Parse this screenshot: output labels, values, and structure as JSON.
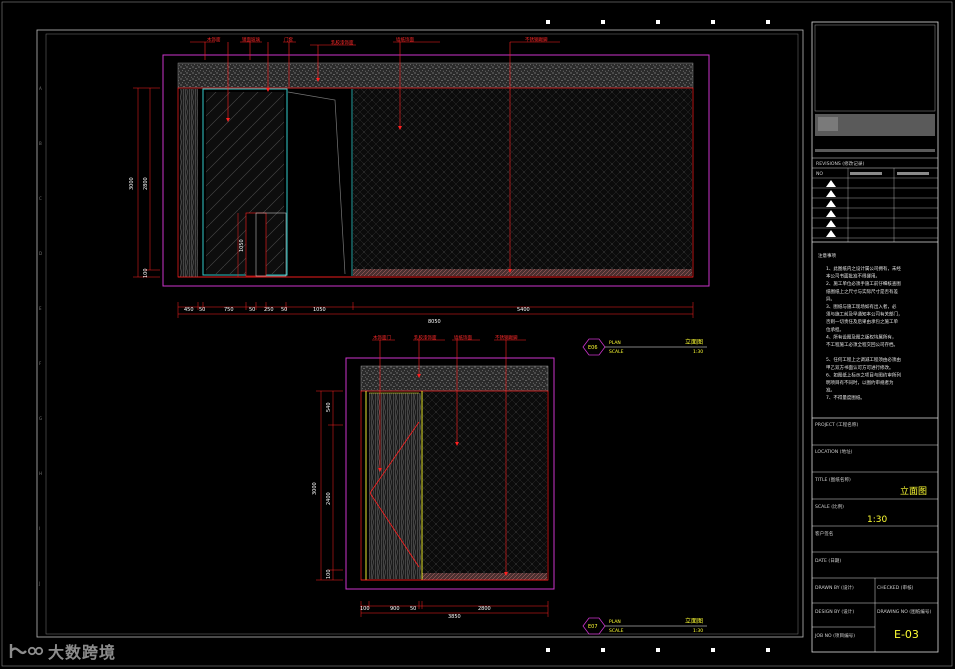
{
  "drawing": {
    "elevation_top": {
      "callouts": [
        "木饰面",
        "镜面玻璃",
        "门套",
        "乳胶漆饰面",
        "墙纸饰面",
        "不锈钢踢脚"
      ],
      "height_dims": [
        "3000",
        "2800",
        "100"
      ],
      "door_dim": "1050",
      "width_dims": [
        "450",
        "50",
        "750",
        "50",
        "250",
        "50",
        "1050",
        "5400"
      ],
      "total_width": "8050",
      "marker": {
        "code": "E06",
        "plan": "PLAN",
        "scale_word": "SCALE",
        "title": "立面图",
        "scale": "1:30"
      }
    },
    "elevation_bottom": {
      "callouts": [
        "木饰面门",
        "乳胶漆饰面",
        "墙纸饰面",
        "不锈钢踢脚"
      ],
      "height_dims": [
        "3000",
        "540",
        "2400",
        "100"
      ],
      "width_dims": [
        "100",
        "900",
        "50",
        "2800"
      ],
      "total_width": "3850",
      "marker": {
        "code": "E07",
        "plan": "PLAN",
        "scale_word": "SCALE",
        "title": "立面图",
        "scale": "1:30"
      }
    }
  },
  "title_block": {
    "revisions_header": "REVISIONS (修改记录)",
    "rev_col_no": "NO",
    "rev_col_date": "DATE",
    "notes_title": "注意事项",
    "notes": [
      "1、此图纸内之设计属公司拥有，未经",
      "本公司书面批准不得挪用。",
      "2、施工单位必须手施工前仔细核查图",
      "纸图纸上之尺寸与实际尺寸是否有差",
      "异。",
      "3、图纸与施工现场如有出入者，必",
      "须与施工前及早通知本公司有关部门，",
      "否则一切责任及后果由承包之施工单",
      "位承担。",
      "4、所有设图及图之版权均属所有，",
      "不工程施工必须全程交回公司存档。",
      "",
      "5、任何工程上之调减工程须由必须由",
      "甲乙双方书面认可方可进行修改。",
      "6、如图纸上标示之项目与图约审所列",
      "明项目有不同时，以图约审规者为",
      "准。",
      "7、不得量度图纸。"
    ],
    "project_label": "PROJECT (工程名称)",
    "location_label": "LOCATION (地址)",
    "title_label": "TITLE (图纸名称)",
    "title_value": "立面图",
    "scale_label": "SCALE (比例)",
    "scale_value": "1:30",
    "client_label": "客户签名",
    "date_label": "DATE (日期)",
    "drawn_label": "DRAWN BY (设计)",
    "checked_label": "CHECKED (审核)",
    "design_label": "DESIGN BY (设计)",
    "drawing_no_label": "DRAWING NO (图纸编号)",
    "job_label": "JOB NO (项目编号)",
    "drawing_no": "E-03"
  },
  "watermark": {
    "brand": "大数跨境"
  },
  "colors": {
    "background": "#000000",
    "outline": "#cc33cc",
    "annotation": "#ff2020",
    "accent": "#ffff00",
    "glass": "#33cccc"
  }
}
